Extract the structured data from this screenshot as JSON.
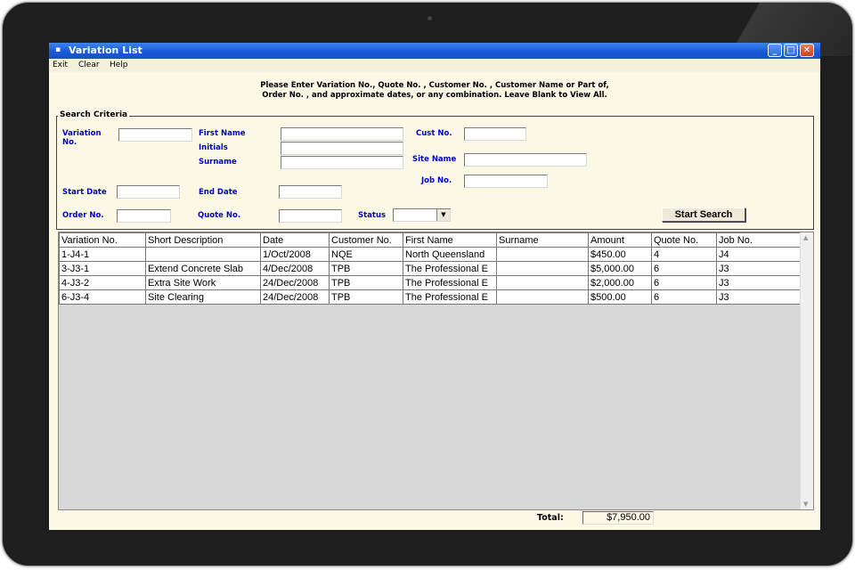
{
  "window": {
    "title": "Variation List"
  },
  "menu": {
    "exit": "Exit",
    "clear": "Clear",
    "help": "Help"
  },
  "instructions": {
    "line1": "Please Enter Variation No., Quote No. , Customer No. , Customer Name or Part of,",
    "line2": "Order No. , and approximate dates, or any combination. Leave Blank to View All."
  },
  "search": {
    "legend": "Search Criteria",
    "variation_no_label": "Variation No.",
    "first_name_label": "First Name",
    "initials_label": "Initials",
    "surname_label": "Surname",
    "cust_no_label": "Cust No.",
    "site_name_label": "Site Name",
    "job_no_label": "Job No.",
    "start_date_label": "Start Date",
    "end_date_label": "End Date",
    "order_no_label": "Order No.",
    "quote_no_label": "Quote No.",
    "status_label": "Status",
    "values": {
      "variation_no": "",
      "first_name": "",
      "initials": "",
      "surname": "",
      "cust_no": "",
      "site_name": "",
      "job_no": "",
      "start_date": "",
      "end_date": "",
      "order_no": "",
      "quote_no": "",
      "status": ""
    },
    "start_button": "Start Search"
  },
  "grid": {
    "columns": [
      "Variation No.",
      "Short Description",
      "Date",
      "Customer No.",
      "First Name",
      "Surname",
      "Amount",
      "Quote No.",
      "Job No."
    ],
    "rows": [
      [
        "1-J4-1",
        "",
        "1/Oct/2008",
        "NQE",
        "North Queensland",
        "",
        "$450.00",
        "4",
        "J4"
      ],
      [
        "3-J3-1",
        "Extend Concrete Slab",
        "4/Dec/2008",
        "TPB",
        "The Professional E",
        "",
        "$5,000.00",
        "6",
        "J3"
      ],
      [
        "4-J3-2",
        "Extra Site Work",
        "24/Dec/2008",
        "TPB",
        "The Professional E",
        "",
        "$2,000.00",
        "6",
        "J3"
      ],
      [
        "6-J3-4",
        "Site Clearing",
        "24/Dec/2008",
        "TPB",
        "The Professional E",
        "",
        "$500.00",
        "6",
        "J3"
      ]
    ]
  },
  "total": {
    "label": "Total:",
    "value": "$7,950.00"
  },
  "icons": {
    "app": "window-app-icon",
    "minimize": "minimize-icon",
    "maximize": "maximize-icon",
    "close": "close-icon",
    "dropdown": "chevron-down-icon"
  },
  "colors": {
    "titlebar": "#1959d9",
    "label_blue": "#0000cc",
    "window_bg": "#fbf8e6"
  }
}
